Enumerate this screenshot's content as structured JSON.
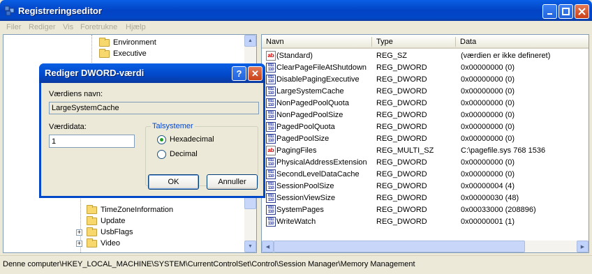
{
  "window": {
    "title": "Registreringseditor"
  },
  "menu": [
    "Filer",
    "Rediger",
    "Vis",
    "Foretrukne",
    "Hjælp"
  ],
  "tree": {
    "nodes": [
      {
        "label": "Environment",
        "expander": ""
      },
      {
        "label": "Executive",
        "expander": ""
      },
      {
        "label": "TimeZoneInformation",
        "expander": ""
      },
      {
        "label": "Update",
        "expander": ""
      },
      {
        "label": "UsbFlags",
        "expander": "+"
      },
      {
        "label": "Video",
        "expander": "+"
      }
    ]
  },
  "list": {
    "headers": {
      "name": "Navn",
      "type": "Type",
      "data": "Data"
    },
    "rows": [
      {
        "icon": "string-value-icon",
        "name": "(Standard)",
        "type": "REG_SZ",
        "data": "(værdien er ikke defineret)"
      },
      {
        "icon": "binary-value-icon",
        "name": "ClearPageFileAtShutdown",
        "type": "REG_DWORD",
        "data": "0x00000000 (0)"
      },
      {
        "icon": "binary-value-icon",
        "name": "DisablePagingExecutive",
        "type": "REG_DWORD",
        "data": "0x00000000 (0)"
      },
      {
        "icon": "binary-value-icon",
        "name": "LargeSystemCache",
        "type": "REG_DWORD",
        "data": "0x00000000 (0)"
      },
      {
        "icon": "binary-value-icon",
        "name": "NonPagedPoolQuota",
        "type": "REG_DWORD",
        "data": "0x00000000 (0)"
      },
      {
        "icon": "binary-value-icon",
        "name": "NonPagedPoolSize",
        "type": "REG_DWORD",
        "data": "0x00000000 (0)"
      },
      {
        "icon": "binary-value-icon",
        "name": "PagedPoolQuota",
        "type": "REG_DWORD",
        "data": "0x00000000 (0)"
      },
      {
        "icon": "binary-value-icon",
        "name": "PagedPoolSize",
        "type": "REG_DWORD",
        "data": "0x00000000 (0)"
      },
      {
        "icon": "string-value-icon",
        "name": "PagingFiles",
        "type": "REG_MULTI_SZ",
        "data": "C:\\pagefile.sys 768 1536"
      },
      {
        "icon": "binary-value-icon",
        "name": "PhysicalAddressExtension",
        "type": "REG_DWORD",
        "data": "0x00000000 (0)"
      },
      {
        "icon": "binary-value-icon",
        "name": "SecondLevelDataCache",
        "type": "REG_DWORD",
        "data": "0x00000000 (0)"
      },
      {
        "icon": "binary-value-icon",
        "name": "SessionPoolSize",
        "type": "REG_DWORD",
        "data": "0x00000004 (4)"
      },
      {
        "icon": "binary-value-icon",
        "name": "SessionViewSize",
        "type": "REG_DWORD",
        "data": "0x00000030 (48)"
      },
      {
        "icon": "binary-value-icon",
        "name": "SystemPages",
        "type": "REG_DWORD",
        "data": "0x00033000 (208896)"
      },
      {
        "icon": "binary-value-icon",
        "name": "WriteWatch",
        "type": "REG_DWORD",
        "data": "0x00000001 (1)"
      }
    ]
  },
  "status": {
    "path": "Denne computer\\HKEY_LOCAL_MACHINE\\SYSTEM\\CurrentControlSet\\Control\\Session Manager\\Memory Management"
  },
  "dialog": {
    "title": "Rediger DWORD-værdi",
    "name_label": "Værdiens navn:",
    "name_value": "LargeSystemCache",
    "data_label": "Værdidata:",
    "data_value": "1",
    "group_label": "Talsystemer",
    "radio_hex": "Hexadecimal",
    "radio_dec": "Decimal",
    "selected_base": "Hexadecimal",
    "ok": "OK",
    "cancel": "Annuller",
    "help_glyph": "?",
    "close_glyph": "✕"
  },
  "colors": {
    "titlebar": "#0148c9",
    "accent_green": "#21a121",
    "group_label": "#0046d5"
  }
}
